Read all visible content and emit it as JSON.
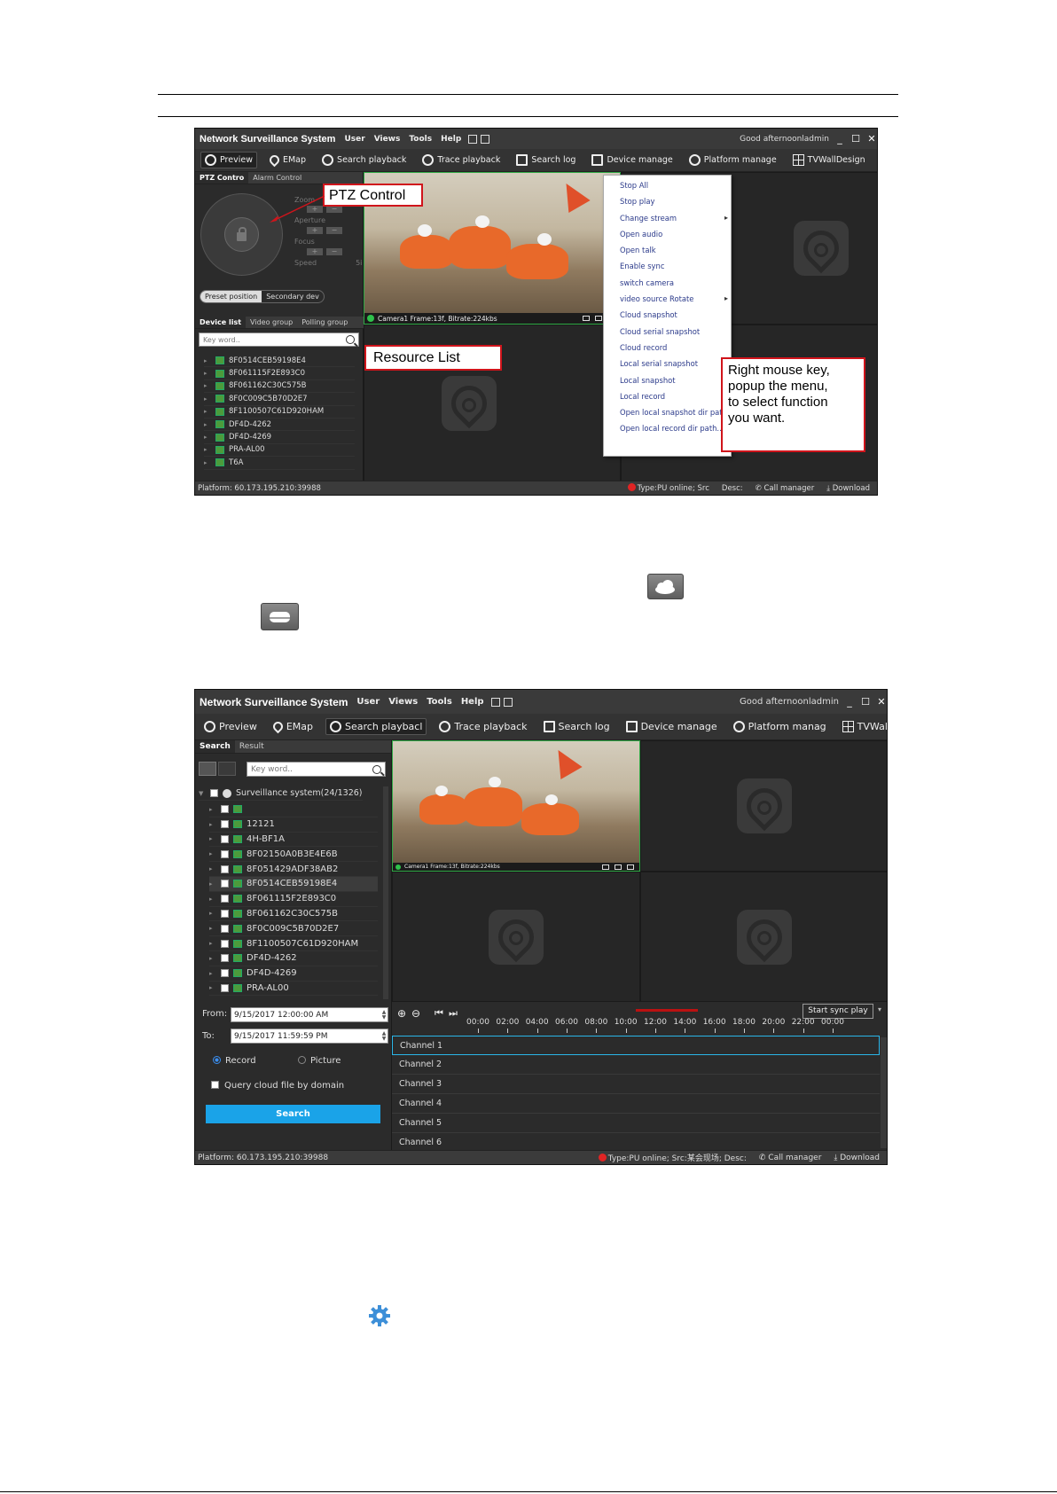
{
  "colors": {
    "accent_blue": "#1aa3e8",
    "callout_red": "#d0141b",
    "online_green": "#2fc14b",
    "alert_red": "#e02424"
  },
  "app": {
    "title": "Network Surveillance System",
    "menus": [
      "User",
      "Views",
      "Tools",
      "Help"
    ],
    "greeting": "Good afternoonladmin",
    "window_buttons": [
      "_",
      "☐",
      "✕"
    ]
  },
  "screenshot1": {
    "toolbar": [
      {
        "label": "Preview",
        "icon": "camera-icon"
      },
      {
        "label": "EMap",
        "icon": "map-pin-icon"
      },
      {
        "label": "Search playback",
        "icon": "play-circle-icon"
      },
      {
        "label": "Trace playback",
        "icon": "trace-icon"
      },
      {
        "label": "Search log",
        "icon": "log-icon"
      },
      {
        "label": "Device manage",
        "icon": "device-icon"
      },
      {
        "label": "Platform manage",
        "icon": "gear-icon"
      },
      {
        "label": "TVWallDesign",
        "icon": "grid-icon"
      }
    ],
    "ptz_tabs": [
      "PTZ Contro",
      "Alarm Control"
    ],
    "ptz_labels": {
      "zoom": "Zoom",
      "aperture": "Aperture",
      "focus": "Focus",
      "speed": "Speed",
      "speed_value": "5i",
      "plus": "+",
      "minus": "−"
    },
    "preset_tabs": [
      "Preset position",
      "Secondary dev"
    ],
    "list_tabs": [
      "Device list",
      "Video group",
      "Polling group"
    ],
    "search_placeholder": "Key word..",
    "devices": [
      "8F0514CEB59198E4",
      "8F061115F2E893C0",
      "8F061162C30C575B",
      "8F0C009C5B70D2E7",
      "8F1100507C61D920HAM",
      "DF4D-4262",
      "DF4D-4269",
      "PRA-AL00",
      "T6A"
    ],
    "camera_status": "Camera1  Frame:13f, Bitrate:224kbs",
    "context_menu": [
      {
        "label": "Stop All",
        "sub": false
      },
      {
        "label": "Stop play",
        "sub": false
      },
      {
        "label": "Change stream",
        "sub": true
      },
      {
        "label": "Open audio",
        "sub": false
      },
      {
        "label": "Open talk",
        "sub": false
      },
      {
        "label": "Enable sync",
        "sub": false
      },
      {
        "label": "switch camera",
        "sub": false
      },
      {
        "label": "video source Rotate",
        "sub": true
      },
      {
        "label": "Cloud snapshot",
        "sub": false
      },
      {
        "label": "Cloud serial snapshot",
        "sub": false
      },
      {
        "label": "Cloud record",
        "sub": false
      },
      {
        "label": "Local serial snapshot",
        "sub": false
      },
      {
        "label": "Local snapshot",
        "sub": false
      },
      {
        "label": "Local record",
        "sub": false
      },
      {
        "label": "Open local snapshot dir path..",
        "sub": false
      },
      {
        "label": "Open local record dir path..",
        "sub": false
      }
    ],
    "callouts": {
      "ptz": "PTZ Control",
      "resource": "Resource List",
      "right_click": [
        "Right mouse key,",
        "popup the menu,",
        "to select function",
        "you want."
      ]
    },
    "status": {
      "platform": "Platform: 60.173.195.210:39988",
      "type": "Type:PU online; Src",
      "desc": "Desc:",
      "call": "Call manager",
      "download": "Download"
    }
  },
  "screenshot2": {
    "toolbar": [
      {
        "label": "Preview",
        "icon": "camera-icon"
      },
      {
        "label": "EMap",
        "icon": "map-pin-icon"
      },
      {
        "label": "Search playbacl",
        "icon": "play-circle-icon"
      },
      {
        "label": "Trace playback",
        "icon": "trace-icon"
      },
      {
        "label": "Search log",
        "icon": "log-icon"
      },
      {
        "label": "Device manage",
        "icon": "device-icon"
      },
      {
        "label": "Platform manag",
        "icon": "gear-icon"
      },
      {
        "label": "TVWallDesign",
        "icon": "grid-icon"
      }
    ],
    "tabs": [
      "Search",
      "Result"
    ],
    "search_placeholder": "Key word..",
    "tree_root": "Surveillance system(24/1326)",
    "tree": [
      "",
      "12121",
      "4H-BF1A",
      "8F02150A0B3E4E6B",
      "8F051429ADF38AB2",
      "8F0514CEB59198E4",
      "8F061115F2E893C0",
      "8F061162C30C575B",
      "8F0C009C5B70D2E7",
      "8F1100507C61D920HAM",
      "DF4D-4262",
      "DF4D-4269",
      "PRA-AL00"
    ],
    "selected_index": 5,
    "from_label": "From:",
    "from_value": "9/15/2017 12:00:00 AM",
    "to_label": "To:",
    "to_value": "9/15/2017 11:59:59 PM",
    "record_label": "Record",
    "picture_label": "Picture",
    "cloud_label": "Query cloud file by domain",
    "search_button": "Search",
    "camera_status": "Camera1  Frame:13f, Bitrate:224kbs",
    "sync_button": "Start sync play",
    "timeline_ticks": [
      "00:00",
      "02:00",
      "04:00",
      "06:00",
      "08:00",
      "10:00",
      "12:00",
      "14:00",
      "16:00",
      "18:00",
      "20:00",
      "22:00",
      "00:00"
    ],
    "channels": [
      "Channel 1",
      "Channel 2",
      "Channel 3",
      "Channel 4",
      "Channel 5",
      "Channel 6"
    ],
    "status": {
      "platform": "Platform: 60.173.195.210:39988",
      "type": "Type:PU online; Src:某会现场; Desc:",
      "call": "Call manager",
      "download": "Download"
    }
  }
}
